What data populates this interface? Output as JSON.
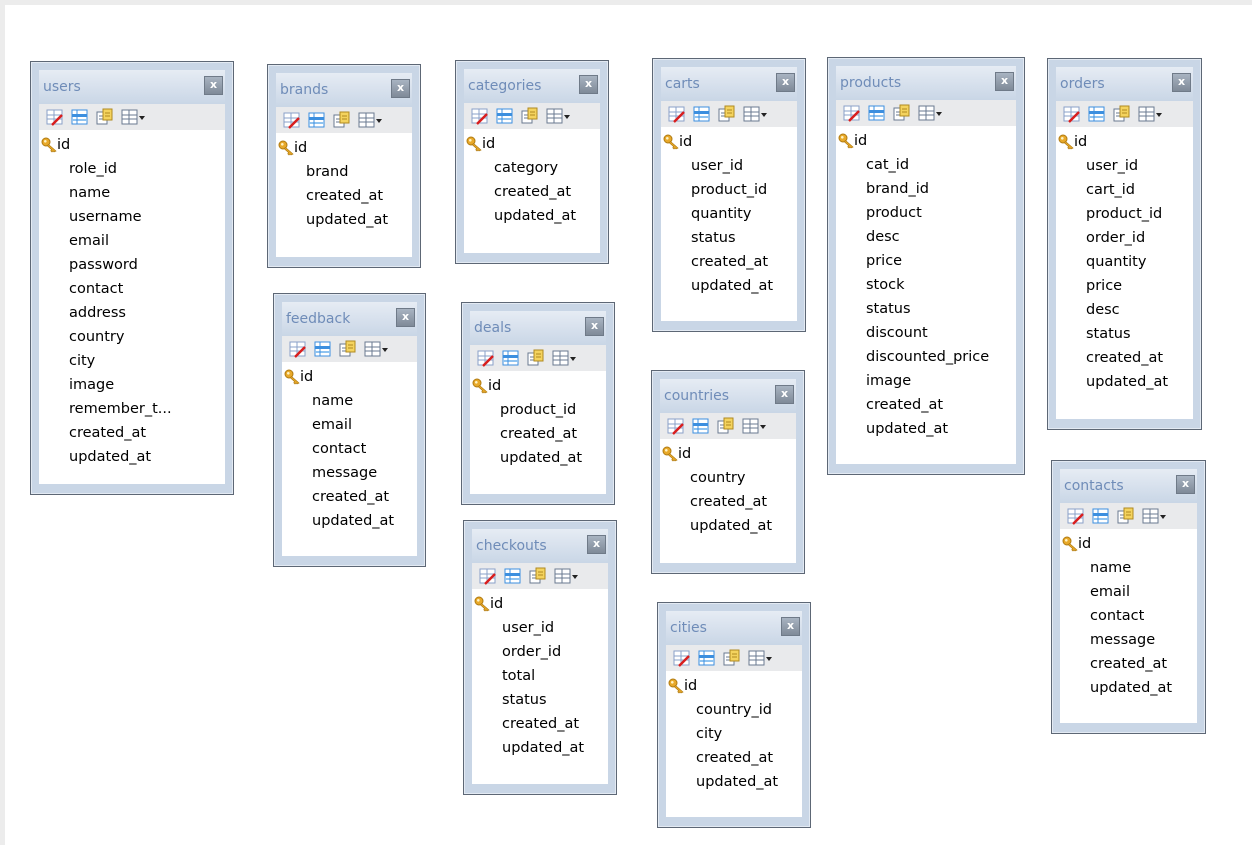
{
  "colors": {
    "frame": "#c9d6e6",
    "title_text": "#6f8cb8",
    "close_button": "#8f9aa8",
    "toolbar": "#e9eaec",
    "key_icon": "#e8a92a"
  },
  "icons": {
    "toolbar": [
      "edit-table-icon",
      "table-rows-icon",
      "copy-table-icon",
      "table-menu-icon"
    ],
    "primary_key": "key-icon",
    "close": "close-icon"
  },
  "close_label": "x",
  "tables": [
    {
      "name": "users",
      "columns": [
        "id",
        "role_id",
        "name",
        "username",
        "email",
        "password",
        "contact",
        "address",
        "country",
        "city",
        "image",
        "remember_t...",
        "created_at",
        "updated_at"
      ]
    },
    {
      "name": "brands",
      "columns": [
        "id",
        "brand",
        "created_at",
        "updated_at"
      ]
    },
    {
      "name": "feedback",
      "columns": [
        "id",
        "name",
        "email",
        "contact",
        "message",
        "created_at",
        "updated_at"
      ]
    },
    {
      "name": "categories",
      "columns": [
        "id",
        "category",
        "created_at",
        "updated_at"
      ]
    },
    {
      "name": "deals",
      "columns": [
        "id",
        "product_id",
        "created_at",
        "updated_at"
      ]
    },
    {
      "name": "checkouts",
      "columns": [
        "id",
        "user_id",
        "order_id",
        "total",
        "status",
        "created_at",
        "updated_at"
      ]
    },
    {
      "name": "carts",
      "columns": [
        "id",
        "user_id",
        "product_id",
        "quantity",
        "status",
        "created_at",
        "updated_at"
      ]
    },
    {
      "name": "countries",
      "columns": [
        "id",
        "country",
        "created_at",
        "updated_at"
      ]
    },
    {
      "name": "cities",
      "columns": [
        "id",
        "country_id",
        "city",
        "created_at",
        "updated_at"
      ]
    },
    {
      "name": "products",
      "columns": [
        "id",
        "cat_id",
        "brand_id",
        "product",
        "desc",
        "price",
        "stock",
        "status",
        "discount",
        "discounted_price",
        "image",
        "created_at",
        "updated_at"
      ]
    },
    {
      "name": "orders",
      "columns": [
        "id",
        "user_id",
        "cart_id",
        "product_id",
        "order_id",
        "quantity",
        "price",
        "desc",
        "status",
        "created_at",
        "updated_at"
      ]
    },
    {
      "name": "contacts",
      "columns": [
        "id",
        "name",
        "email",
        "contact",
        "message",
        "created_at",
        "updated_at"
      ]
    }
  ]
}
